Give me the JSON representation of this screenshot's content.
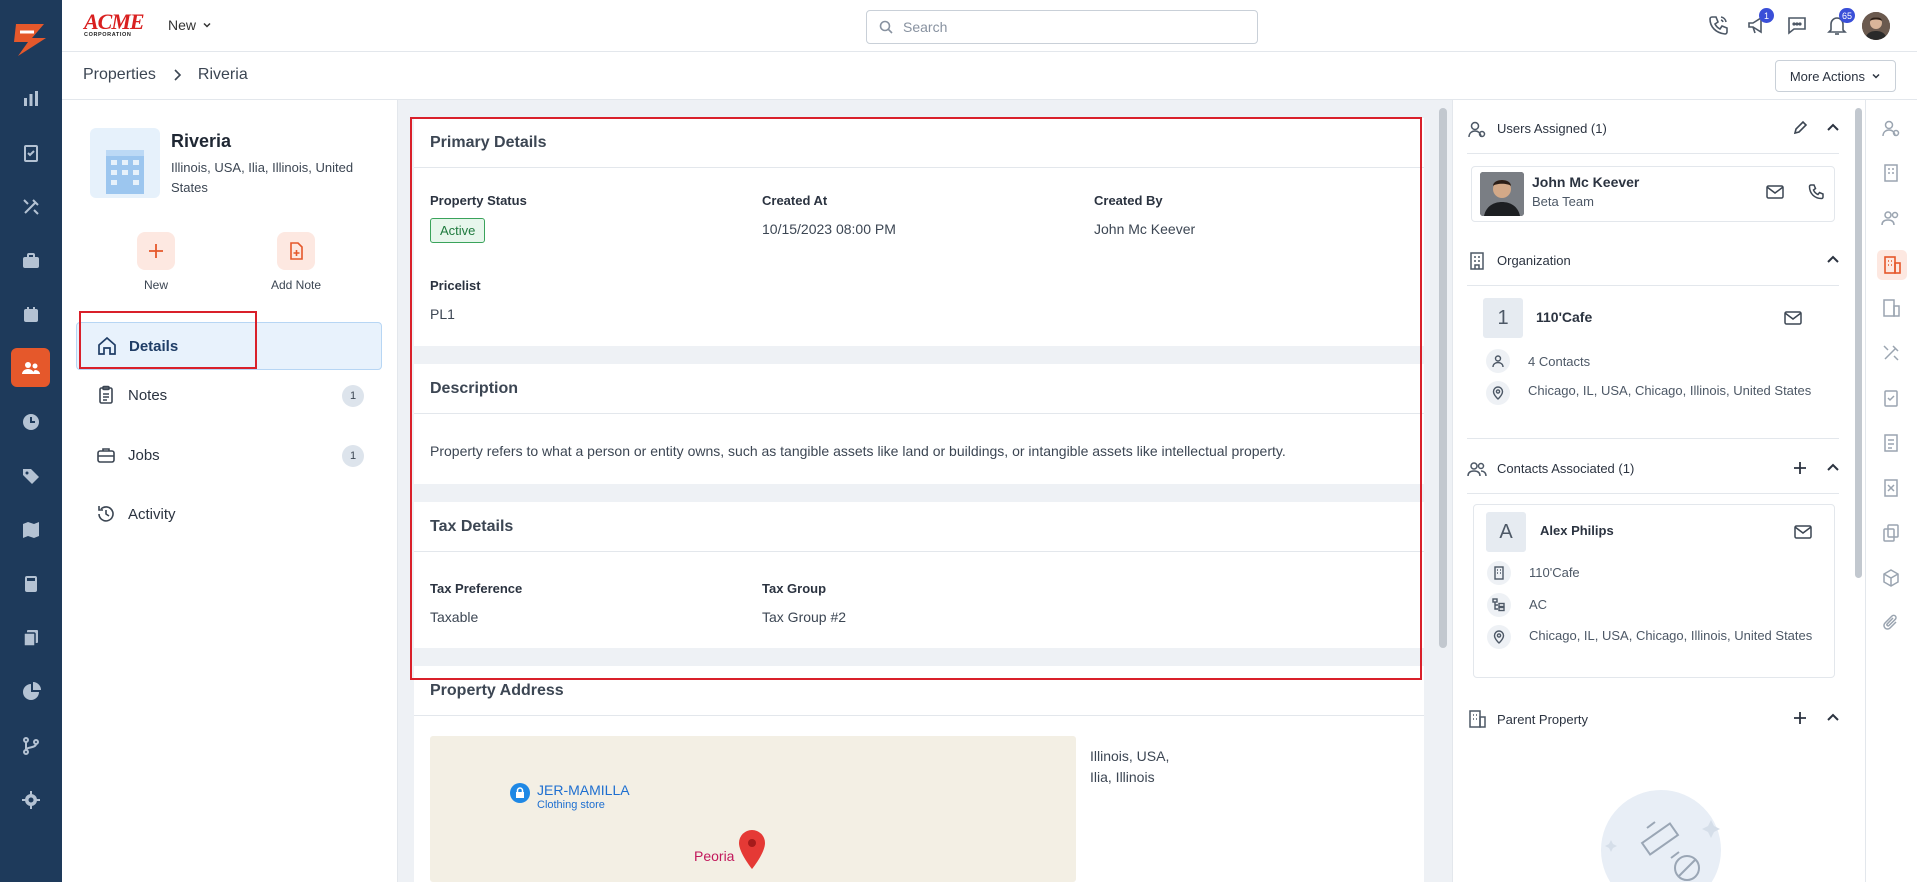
{
  "topbar": {
    "brand": "ACME",
    "brand_sub": "CORPORATION",
    "new_label": "New",
    "search_placeholder": "Search",
    "announce_badge": "1",
    "notif_badge": "65"
  },
  "breadcrumb": {
    "parent": "Properties",
    "current": "Riveria"
  },
  "more_actions": "More Actions",
  "property": {
    "name": "Riveria",
    "address": "Illinois, USA, Ilia, Illinois, United States"
  },
  "quick_actions": {
    "new": "New",
    "add_note": "Add Note"
  },
  "nav": {
    "details": "Details",
    "notes": "Notes",
    "notes_count": "1",
    "jobs": "Jobs",
    "jobs_count": "1",
    "activity": "Activity"
  },
  "primary_details": {
    "title": "Primary Details",
    "status_label": "Property Status",
    "status": "Active",
    "created_at_label": "Created At",
    "created_at": "10/15/2023 08:00 PM",
    "created_by_label": "Created By",
    "created_by": "John Mc Keever",
    "pricelist_label": "Pricelist",
    "pricelist": "PL1"
  },
  "description": {
    "title": "Description",
    "text": "Property refers to what a person or entity owns, such as tangible assets like land or buildings, or intangible assets like intellectual property."
  },
  "tax": {
    "title": "Tax Details",
    "pref_label": "Tax Preference",
    "pref": "Taxable",
    "group_label": "Tax Group",
    "group": "Tax Group #2"
  },
  "address": {
    "title": "Property Address",
    "line1": "Illinois, USA,",
    "line2": "Ilia, Illinois",
    "map_place": "JER-MAMILLA",
    "map_place_sub": "Clothing store",
    "map_city": "Peoria"
  },
  "users": {
    "title": "Users Assigned (1)",
    "name": "John Mc Keever",
    "team": "Beta Team"
  },
  "organization": {
    "title": "Organization",
    "initial": "1",
    "name": "110'Cafe",
    "contacts": "4 Contacts",
    "address": "Chicago, IL, USA, Chicago, Illinois, United States"
  },
  "contacts": {
    "title": "Contacts Associated (1)",
    "initial": "A",
    "name": "Alex Philips",
    "org": "110'Cafe",
    "code": "AC",
    "address": "Chicago, IL, USA, Chicago, Illinois, United States"
  },
  "parent_property": {
    "title": "Parent Property"
  },
  "colors": {
    "rail": "#1e3a5b",
    "accent": "#e5582b",
    "highlight": "#d9202a"
  }
}
